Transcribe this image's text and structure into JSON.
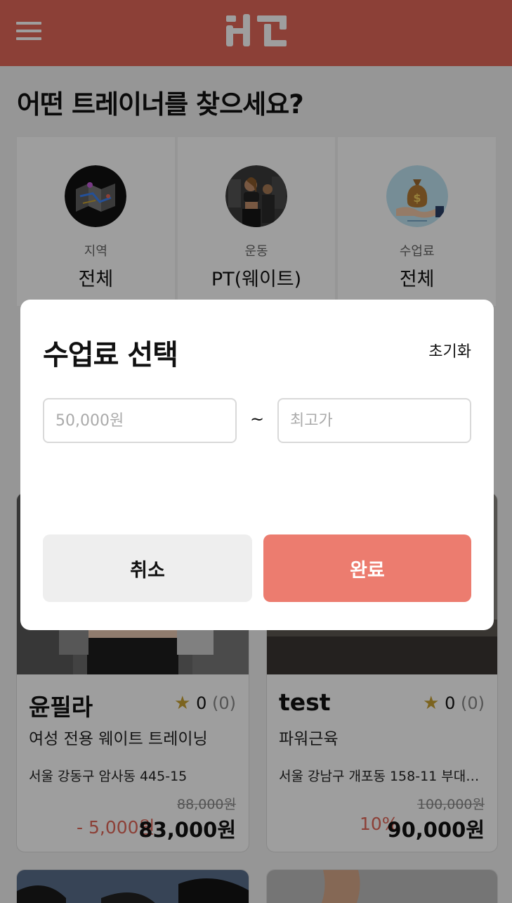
{
  "header": {
    "menu_icon": "hamburger-menu-icon",
    "logo_icon": "brand-logo-icon"
  },
  "page_title": "어떤 트레이너를 찾으세요?",
  "filters": [
    {
      "label": "지역",
      "value": "전체",
      "icon": "map-icon"
    },
    {
      "label": "운동",
      "value": "PT(웨이트)",
      "icon": "trainer-photo-icon"
    },
    {
      "label": "수업료",
      "value": "전체",
      "icon": "money-bag-icon"
    }
  ],
  "cards": [
    {
      "name": "윤필라",
      "rating": "0",
      "rating_count": "(0)",
      "subtitle": "여성 전용 웨이트 트레이닝",
      "address": "서울 강동구 암사동 445-15",
      "original_price": "88,000원",
      "discount": "- 5,000원",
      "price": "83,000원"
    },
    {
      "name": "test",
      "rating": "0",
      "rating_count": "(0)",
      "subtitle": "파워근육",
      "address": "서울 강남구 개포동 158-11 부대…",
      "original_price": "100,000원",
      "discount": "10%",
      "price": "90,000원"
    }
  ],
  "modal": {
    "title": "수업료 선택",
    "reset_label": "초기화",
    "min_placeholder": "50,000원",
    "max_placeholder": "최고가",
    "separator": "~",
    "cancel_label": "취소",
    "confirm_label": "완료"
  },
  "colors": {
    "brand": "#e3685a",
    "confirm": "#ec7c6f",
    "star": "#c9a233"
  }
}
